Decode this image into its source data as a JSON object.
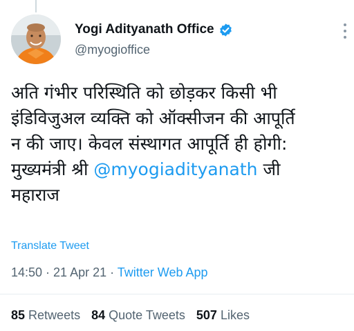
{
  "author": {
    "display_name": "Yogi Adityanath Office",
    "handle": "@myogioffice",
    "verified_icon": "verified-badge-icon",
    "avatar_icon": "profile-avatar"
  },
  "tweet": {
    "lines": [
      "अति गंभीर परिस्थिति को छोड़कर किसी भी",
      "इंडिविजुअल व्यक्ति को ऑक्सीजन की आपूर्ति",
      "न की जाए। केवल संस्थागत आपूर्ति ही होगी:"
    ],
    "line4_prefix": "मुख्यमंत्री श्री ",
    "mention": "@myogiadityanath",
    "line4_suffix": " जी",
    "line5": "महाराज"
  },
  "translate_label": "Translate Tweet",
  "meta": {
    "time": "14:50",
    "sep1": " · ",
    "date": "21 Apr 21",
    "sep2": " · ",
    "source": "Twitter Web App"
  },
  "stats": {
    "retweets_count": "85",
    "retweets_label": "Retweets",
    "quotes_count": "84",
    "quotes_label": "Quote Tweets",
    "likes_count": "507",
    "likes_label": "Likes"
  },
  "colors": {
    "accent": "#1d9bf0",
    "text": "#0f1419",
    "secondary": "#536471",
    "divider": "#e6ecf0"
  }
}
